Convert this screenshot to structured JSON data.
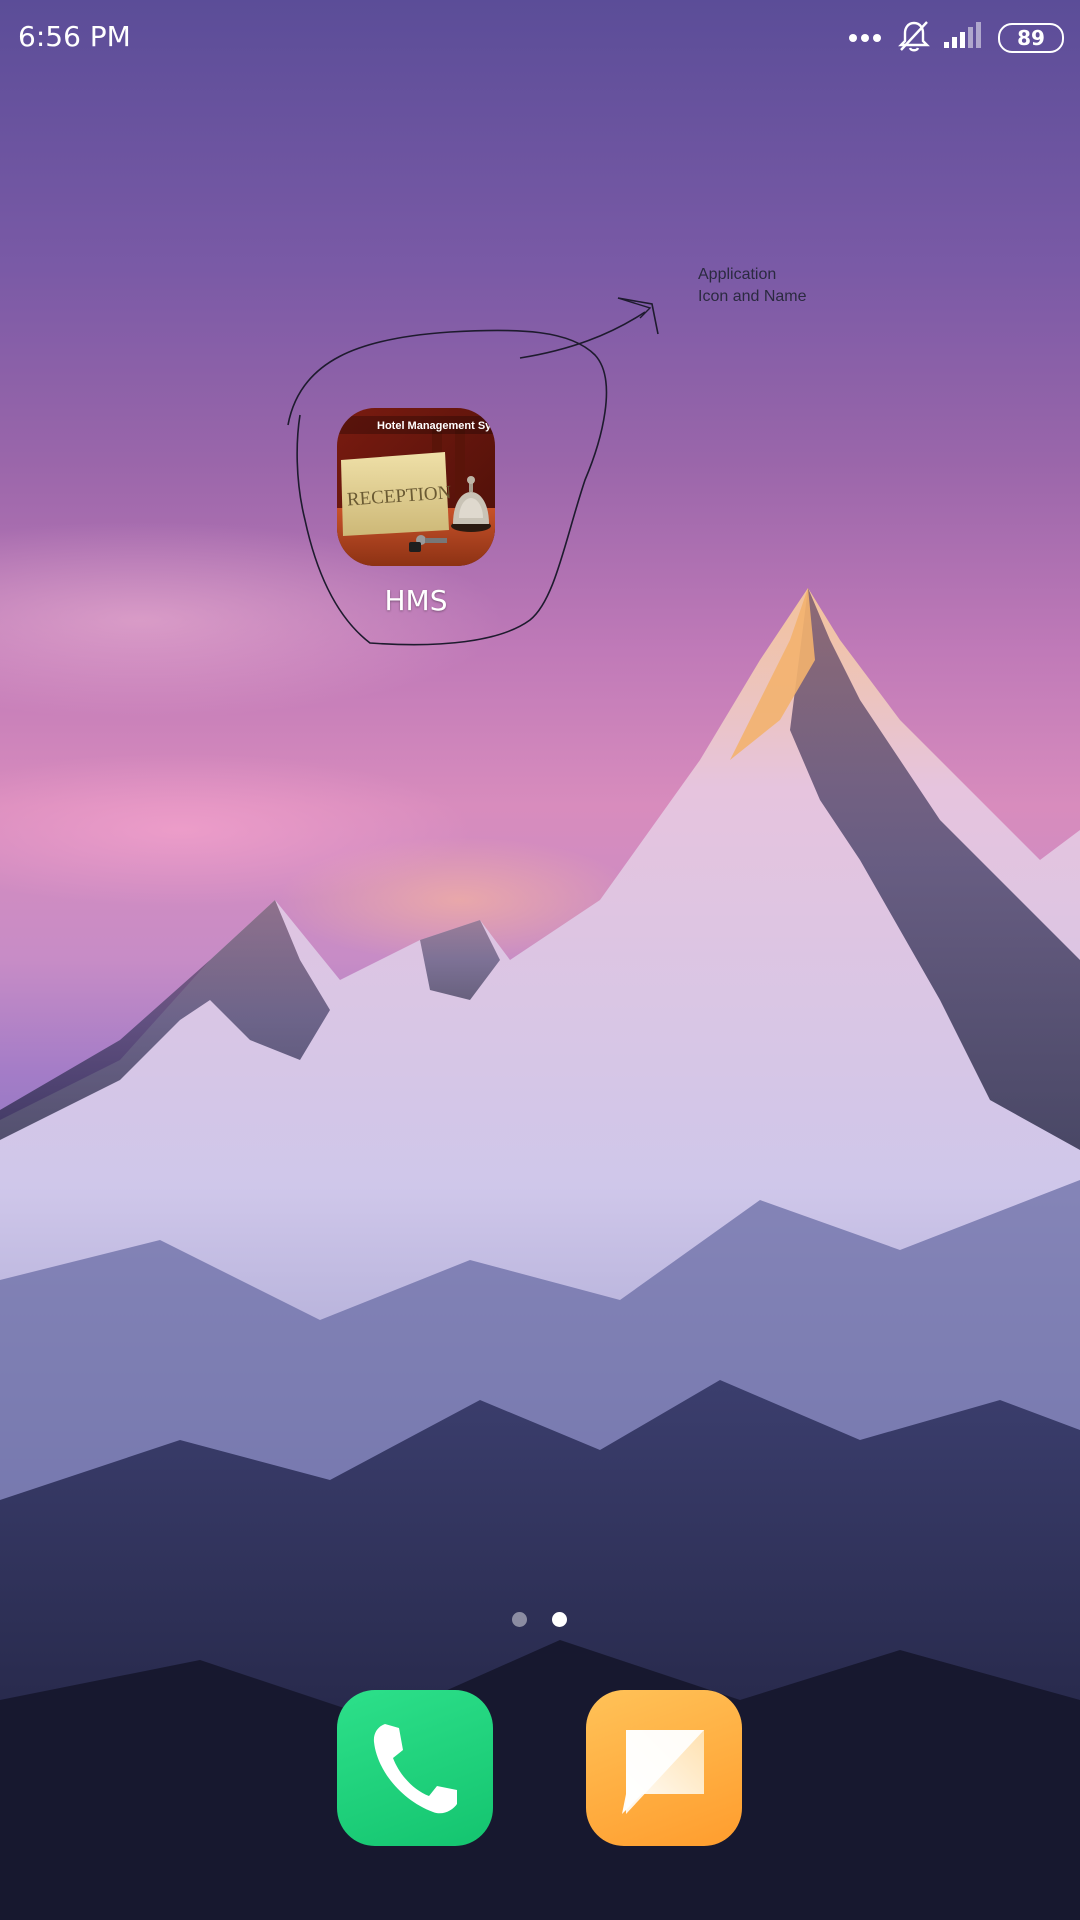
{
  "status_bar": {
    "time": "6:56 PM",
    "battery": "89",
    "icons": [
      "more-dots-icon",
      "bell-muted-icon",
      "signal-icon",
      "battery-icon"
    ]
  },
  "annotation": {
    "line1": "Application",
    "line2": "Icon and Name"
  },
  "apps": [
    {
      "label": "HMS",
      "icon_text_banner": "Hotel Management Sys",
      "icon_text_sign": "RECEPTION"
    }
  ],
  "page_indicator": {
    "pages": 2,
    "current": 2
  },
  "dock": {
    "apps": [
      "phone-icon",
      "messages-icon"
    ]
  },
  "colors": {
    "phone": "#1ccf78",
    "messages": "#ffad3d",
    "annotation_ink": "#2b2a40"
  }
}
